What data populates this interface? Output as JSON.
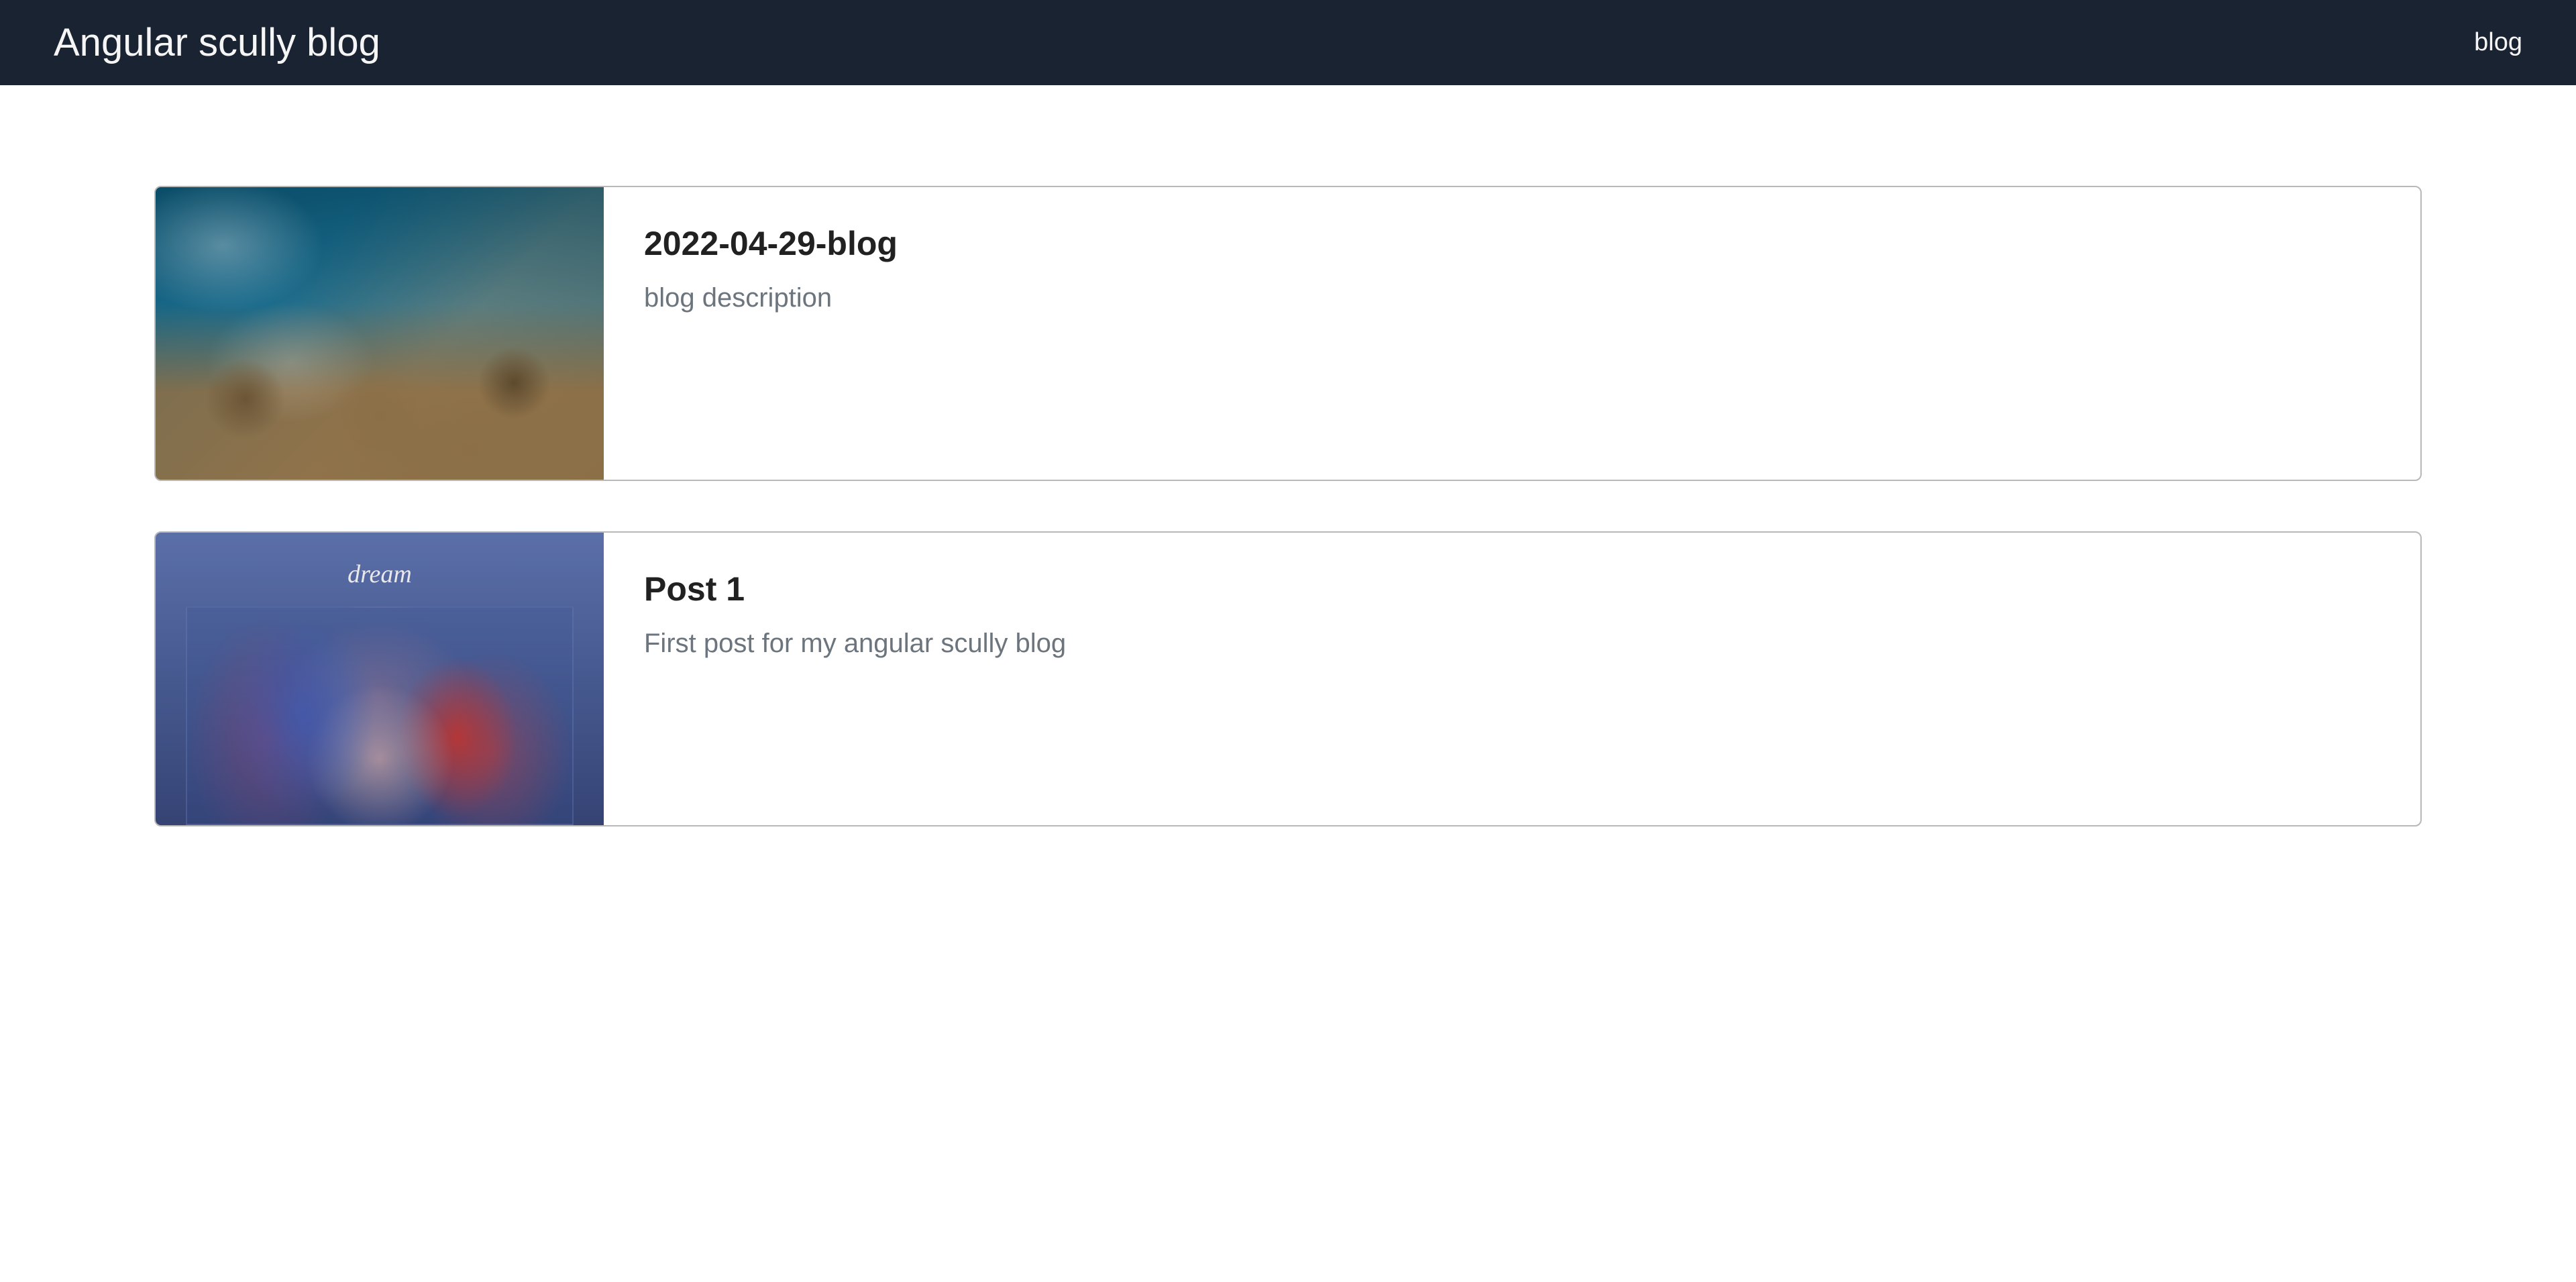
{
  "navbar": {
    "brand": "Angular scully blog",
    "link": "blog"
  },
  "posts": [
    {
      "title": "2022-04-29-blog",
      "description": "blog description",
      "image_label": ""
    },
    {
      "title": "Post 1",
      "description": "First post for my angular scully blog",
      "image_label": "dream"
    }
  ]
}
